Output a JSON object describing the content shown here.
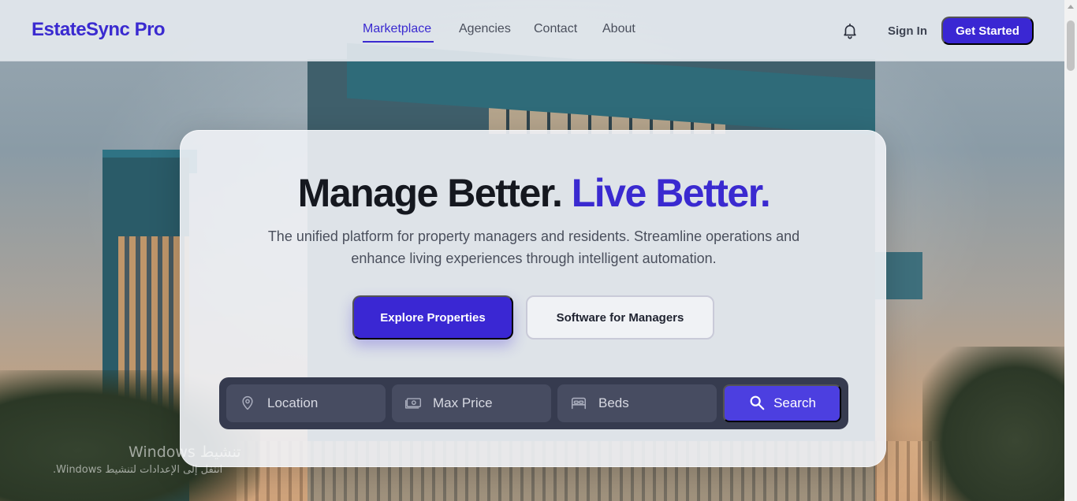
{
  "header": {
    "logo": "EstateSync Pro",
    "nav": [
      {
        "label": "Marketplace",
        "active": true
      },
      {
        "label": "Agencies",
        "active": false
      },
      {
        "label": "Contact",
        "active": false
      },
      {
        "label": "About",
        "active": false
      }
    ],
    "notifications_icon": "bell-icon",
    "sign_in": "Sign In",
    "get_started": "Get Started"
  },
  "hero": {
    "headline_part1": "Manage Better.",
    "headline_part2": "Live Better.",
    "subtitle": "The unified platform for property managers and residents. Streamline operations and enhance living experiences through intelligent automation.",
    "primary_button": "Explore Properties",
    "secondary_button": "Software for Managers"
  },
  "search": {
    "location": {
      "label": "Location",
      "icon": "map-pin-icon"
    },
    "max_price": {
      "label": "Max Price",
      "icon": "cash-icon"
    },
    "beds": {
      "label": "Beds",
      "icon": "bed-icon"
    },
    "button": {
      "label": "Search",
      "icon": "search-icon"
    }
  },
  "watermark": {
    "line1": "Windows تنشيط",
    "line2": "انتقل إلى الإعدادات لتنشيط Windows."
  },
  "colors": {
    "brand": "#3a2ad0",
    "button_primary": "#3a27d3",
    "search_bar_bg": "#363b4f",
    "search_field_bg": "#474c61",
    "search_button": "#4c3fe0"
  }
}
